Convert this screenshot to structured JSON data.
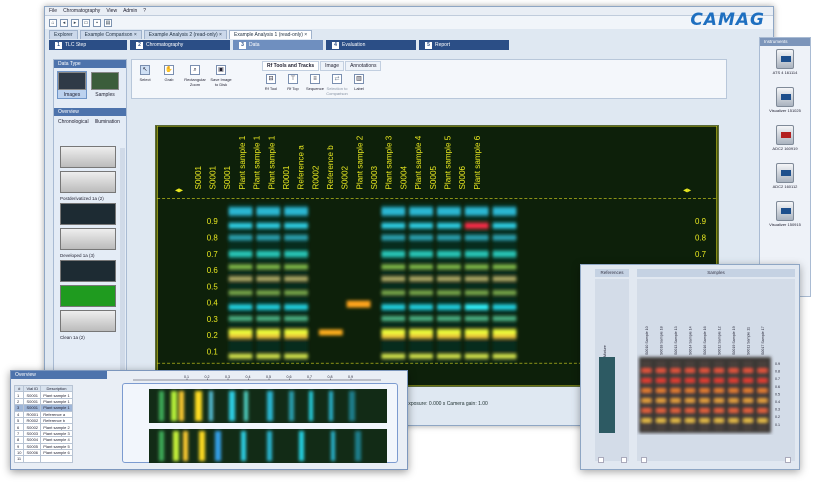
{
  "menubar": [
    "File",
    "Chromatography",
    "View",
    "Admin",
    "?"
  ],
  "brand": "CAMAG",
  "doc_tabs": [
    {
      "label": "Explorer",
      "active": false
    },
    {
      "label": "Example Comparison",
      "active": false
    },
    {
      "label": "Example Analysis 2 (read-only)",
      "active": false
    },
    {
      "label": "Example Analysis 1 (read-only)",
      "active": true
    }
  ],
  "workflow": [
    {
      "num": "1",
      "label": "TLC Step",
      "active": false
    },
    {
      "num": "2",
      "label": "Chromatography",
      "active": false
    },
    {
      "num": "3",
      "label": "Data",
      "active": true
    },
    {
      "num": "4",
      "label": "Evaluation",
      "active": false
    },
    {
      "num": "5",
      "label": "Report",
      "active": false
    }
  ],
  "left_panel": {
    "data_type_title": "Data Type",
    "types": [
      {
        "label": "Images",
        "selected": true
      },
      {
        "label": "Samples",
        "selected": false
      }
    ],
    "overview_title": "Overview",
    "subtabs": [
      "Chronological",
      "Illumination"
    ],
    "thumb_labels": [
      "Postderivatized 1a (2)",
      "Developed 1a (3)",
      "Clean 1a (2)"
    ]
  },
  "ribbon": {
    "buttons": [
      "Select",
      "Grab",
      "Rectangular Zoom",
      "Save Image to Disk"
    ],
    "tabs": [
      "Rf Tools and Tracks",
      "Image",
      "Annotations"
    ],
    "tools": [
      "Rf Tool",
      "Rf Top",
      "Sequence",
      "Selection to Comparison",
      "Label"
    ]
  },
  "plate": {
    "tracks": [
      "S0001",
      "S0001",
      "S0001",
      "Plant sample 1",
      "Plant sample 1",
      "Plant sample 1",
      "R0001",
      "Reference a",
      "R0002",
      "Reference b",
      "S0002",
      "Plant sample 2",
      "S0003",
      "Plant sample 3",
      "S0004",
      "Plant sample 4",
      "S0005",
      "Plant sample 5",
      "S0006",
      "Plant sample 6"
    ],
    "track_columns": [
      {
        "id": "S0001",
        "name": "Plant sample 1"
      },
      {
        "id": "S0001",
        "name": "Plant sample 1"
      },
      {
        "id": "S0001",
        "name": "Plant sample 1"
      },
      {
        "id": "R0001",
        "name": "Reference a"
      },
      {
        "id": "R0002",
        "name": "Reference b"
      },
      {
        "id": "S0002",
        "name": "Plant sample 2"
      },
      {
        "id": "S0003",
        "name": "Plant sample 3"
      },
      {
        "id": "S0004",
        "name": "Plant sample 4"
      },
      {
        "id": "S0005",
        "name": "Plant sample 5"
      },
      {
        "id": "S0006",
        "name": "Plant sample 6"
      }
    ],
    "rf_ticks": [
      "0.9",
      "0.8",
      "0.7",
      "0.6",
      "0.5",
      "0.4",
      "0.3",
      "0.2",
      "0.1"
    ],
    "footer": "Exposure: 0.000 s    Camera gain: 1.00"
  },
  "instruments": {
    "title": "Instruments",
    "items": [
      "ATS 4 161114",
      "Visualizer 151025",
      "ADC2 160919",
      "ADC2 160112",
      "Visualizer 150915"
    ]
  },
  "overview_overlay": {
    "title": "Overview",
    "scale": [
      "0.1",
      "0.2",
      "0.3",
      "0.4",
      "0.5",
      "0.6",
      "0.7",
      "0.8",
      "0.9"
    ],
    "columns": [
      "#",
      "Vial ID",
      "Description"
    ],
    "rows": [
      [
        "1",
        "S0001",
        "Plant sample 1"
      ],
      [
        "2",
        "S0001",
        "Plant sample 1"
      ],
      [
        "3",
        "S0001",
        "Plant sample 1"
      ],
      [
        "4",
        "R0001",
        "Reference a"
      ],
      [
        "5",
        "R0002",
        "Reference b"
      ],
      [
        "6",
        "S0002",
        "Plant sample 2"
      ],
      [
        "7",
        "S0003",
        "Plant sample 3"
      ],
      [
        "8",
        "S0004",
        "Plant sample 4"
      ],
      [
        "9",
        "S0005",
        "Plant sample 5"
      ],
      [
        "10",
        "S0006",
        "Plant sample 6"
      ],
      [
        "11",
        "",
        ""
      ]
    ],
    "selected_row": 2
  },
  "refsamples": {
    "references_title": "References",
    "samples_title": "Samples",
    "ref_label": "Mixture",
    "sample_labels": [
      "S0010 Sample 10",
      "S0018 Sample 18",
      "S0013 Sample 13",
      "S0014 Sample 14",
      "S0016 Sample 16",
      "S0012 Sample 12",
      "S0019 Sample 19",
      "S0011 Sample 11",
      "S0017 Sample 17"
    ],
    "rf_ticks": [
      "0.9",
      "0.8",
      "0.7",
      "0.6",
      "0.5",
      "0.4",
      "0.3",
      "0.2",
      "0.1"
    ]
  }
}
